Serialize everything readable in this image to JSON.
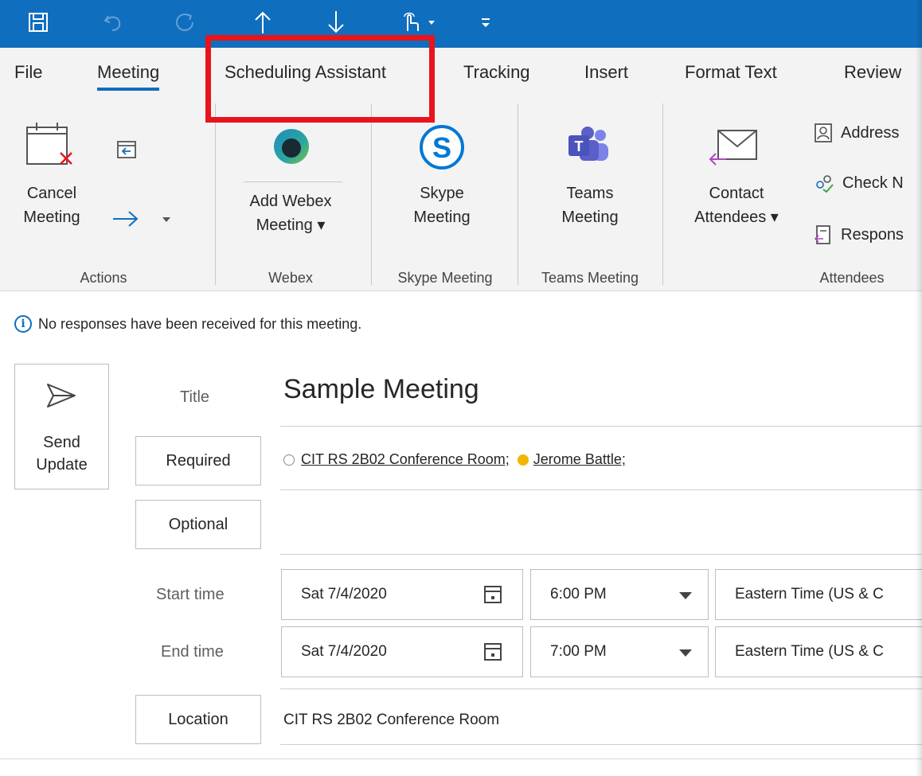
{
  "colors": {
    "accent": "#106ebe",
    "highlight": "#e8141c",
    "tentative": "#f2b600",
    "teams": "#5b5fc7",
    "skype": "#00aff0"
  },
  "quick_access": [
    {
      "name": "save-icon",
      "glyph": "🖫"
    },
    {
      "name": "undo-icon",
      "glyph": "↶"
    },
    {
      "name": "redo-icon",
      "glyph": "↻"
    },
    {
      "name": "previous-item-icon",
      "glyph": "↑"
    },
    {
      "name": "next-item-icon",
      "glyph": "↓"
    },
    {
      "name": "touch-mode-icon",
      "glyph": "☝"
    },
    {
      "name": "customize-toolbar-icon",
      "glyph": "₌"
    }
  ],
  "tabs": {
    "file": "File",
    "meeting": "Meeting",
    "scheduling": "Scheduling Assistant",
    "tracking": "Tracking",
    "insert": "Insert",
    "format_text": "Format Text",
    "review": "Review"
  },
  "ribbon": {
    "actions": {
      "cancel_line1": "Cancel",
      "cancel_line2": "Meeting",
      "group": "Actions"
    },
    "webex": {
      "line1": "Add Webex",
      "line2": "Meeting ▾",
      "group": "Webex"
    },
    "skype": {
      "line1": "Skype",
      "line2": "Meeting",
      "group": "Skype Meeting"
    },
    "teams": {
      "line1": "Teams",
      "line2": "Meeting",
      "group": "Teams Meeting"
    },
    "attendees": {
      "contact_line1": "Contact",
      "contact_line2": "Attendees ▾",
      "address_book": "Address",
      "check_names": "Check N",
      "response": "Respons",
      "group": "Attendees"
    }
  },
  "info_bar": "No responses have been received for this meeting.",
  "form": {
    "send_line1": "Send",
    "send_line2": "Update",
    "title_label": "Title",
    "title_value": "Sample Meeting",
    "required_label": "Required",
    "required_attendees": [
      "CIT RS 2B02 Conference Room;",
      "Jerome Battle;"
    ],
    "optional_label": "Optional",
    "start_label": "Start time",
    "start_date": "Sat 7/4/2020",
    "start_time": "6:00 PM",
    "start_tz": "Eastern Time (US & C",
    "end_label": "End time",
    "end_date": "Sat 7/4/2020",
    "end_time": "7:00 PM",
    "end_tz": "Eastern Time (US & C",
    "location_label": "Location",
    "location_value": "CIT RS 2B02 Conference Room"
  }
}
